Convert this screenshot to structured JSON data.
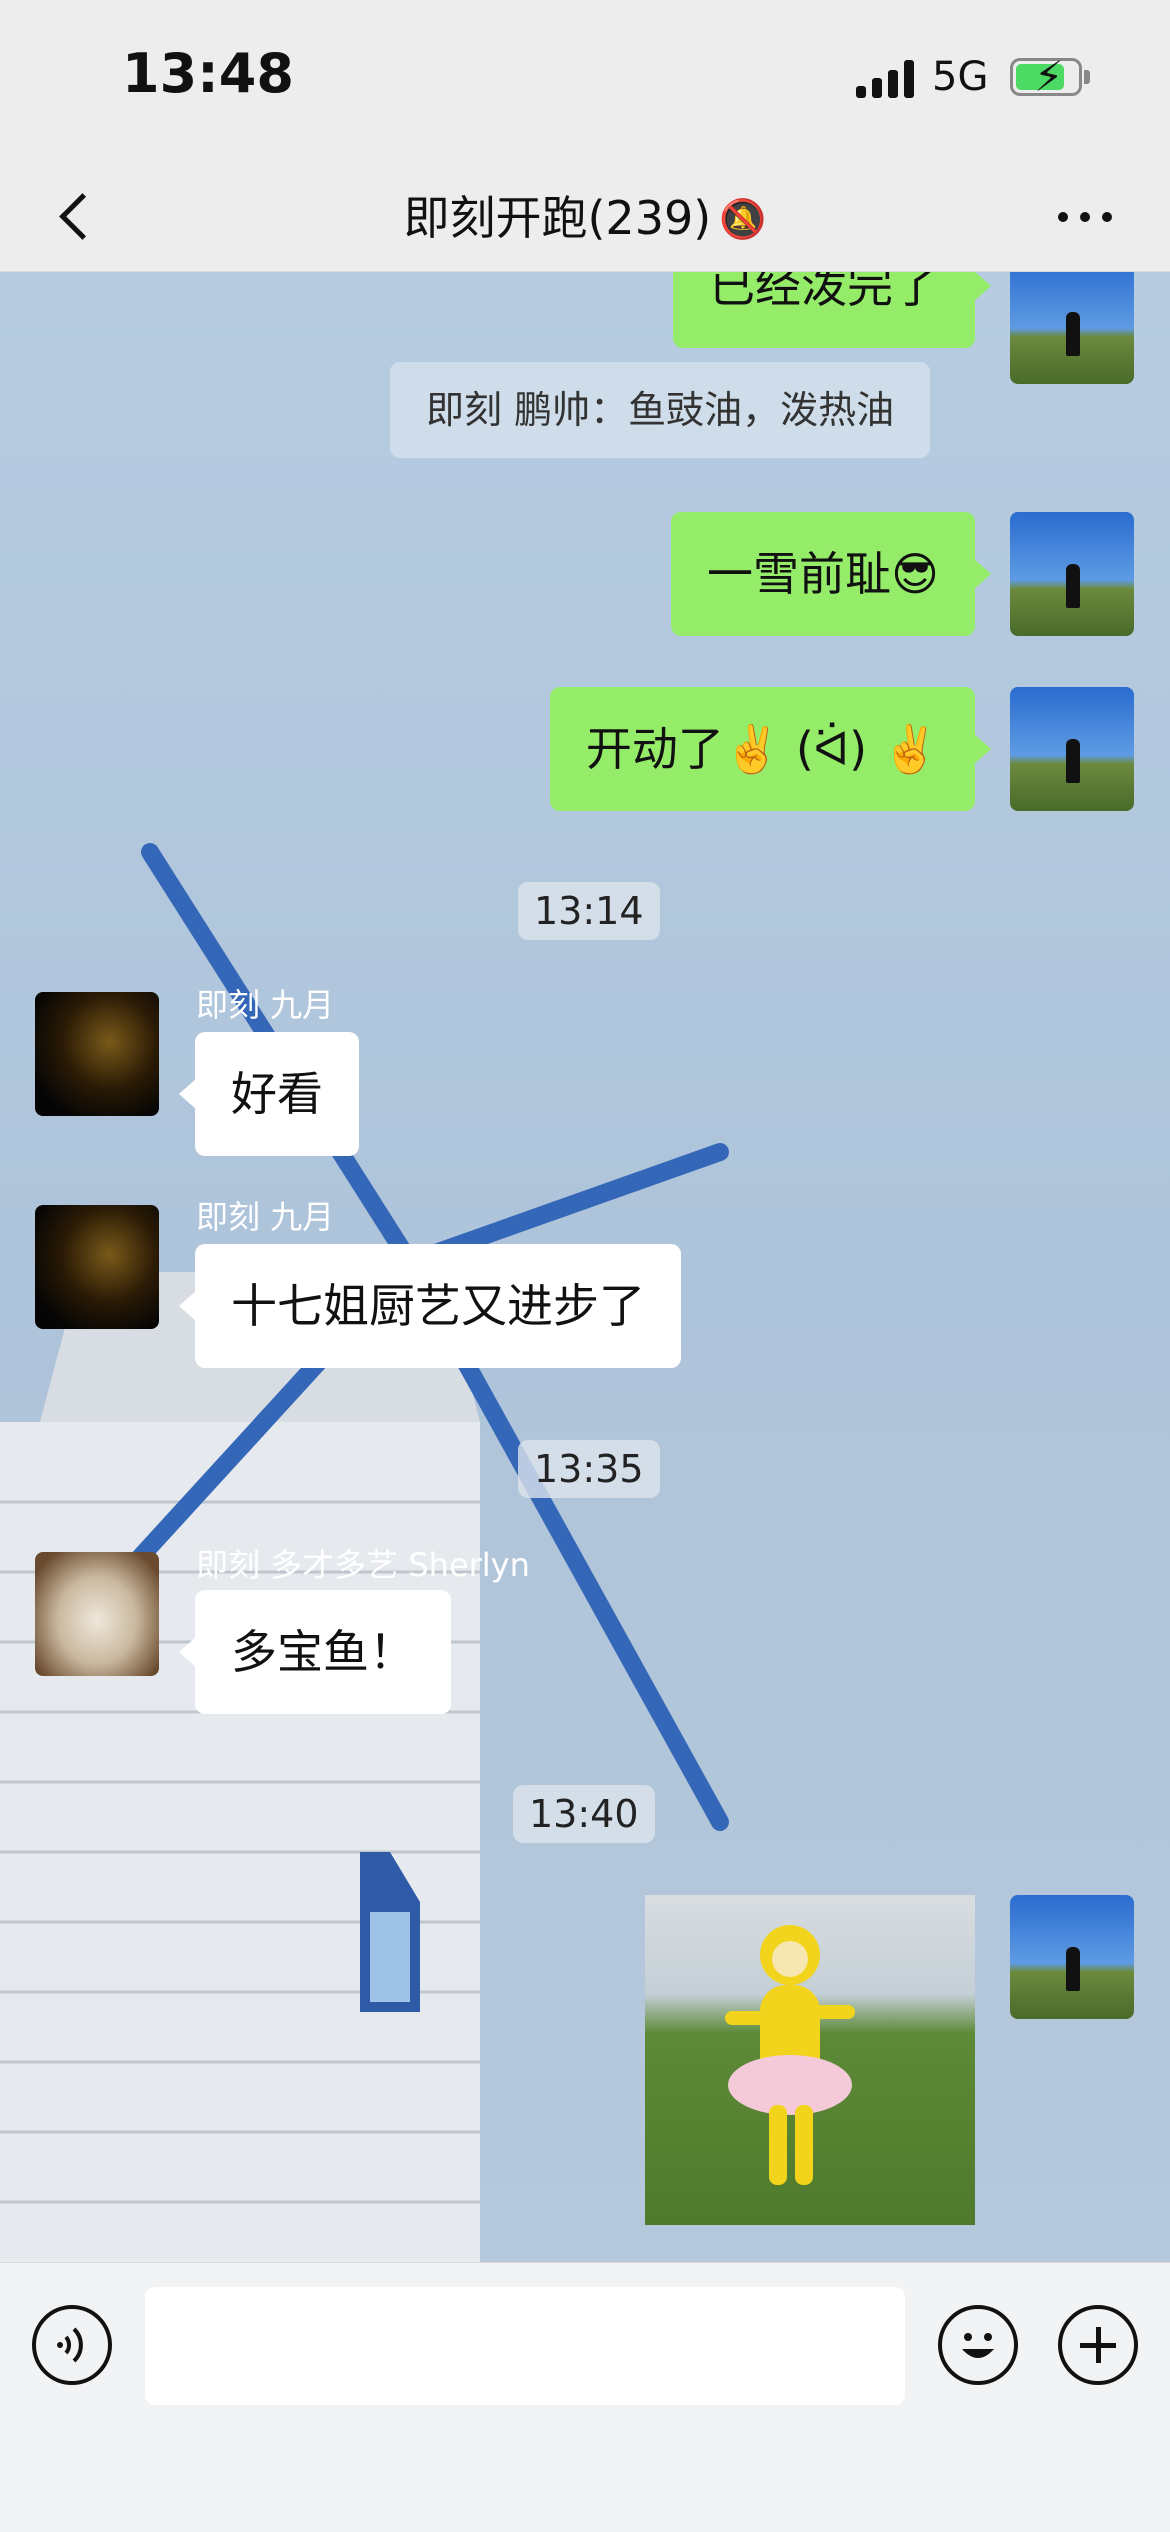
{
  "status_bar": {
    "time": "13:48",
    "network": "5G",
    "battery_icon": "battery-charging-icon"
  },
  "nav": {
    "title": "即刻开跑(239)",
    "back_icon": "chevron-left-icon",
    "mute_icon": "bell-slash-icon",
    "more_icon": "more-dots-icon"
  },
  "messages": [
    {
      "type": "outgoing_text",
      "text": "已经泼完了"
    },
    {
      "type": "system",
      "text": "即刻 鹏帅：鱼豉油，泼热油"
    },
    {
      "type": "outgoing_text",
      "text": "一雪前耻😎"
    },
    {
      "type": "outgoing_text",
      "text": "开动了✌️ (ᐛ) ✌️"
    },
    {
      "type": "timestamp",
      "text": "13:14"
    },
    {
      "type": "incoming_text",
      "sender": "即刻 九月",
      "text": "好看"
    },
    {
      "type": "incoming_text",
      "sender": "即刻 九月",
      "text": "十七姐厨艺又进步了"
    },
    {
      "type": "timestamp",
      "text": "13:35"
    },
    {
      "type": "incoming_text",
      "sender": "即刻 多才多艺 Sherlyn",
      "text": "多宝鱼！"
    },
    {
      "type": "timestamp",
      "text": "13:40"
    },
    {
      "type": "outgoing_image",
      "alt": "teletubby-dancing-gif"
    }
  ],
  "input_bar": {
    "voice_icon": "voice-icon",
    "emoji_icon": "smiley-icon",
    "plus_icon": "plus-circle-icon",
    "placeholder": ""
  },
  "colors": {
    "bubble_outgoing": "#95ec69",
    "bubble_incoming": "#ffffff",
    "chat_background": "#b7cce1",
    "nav_background": "#ededed"
  }
}
